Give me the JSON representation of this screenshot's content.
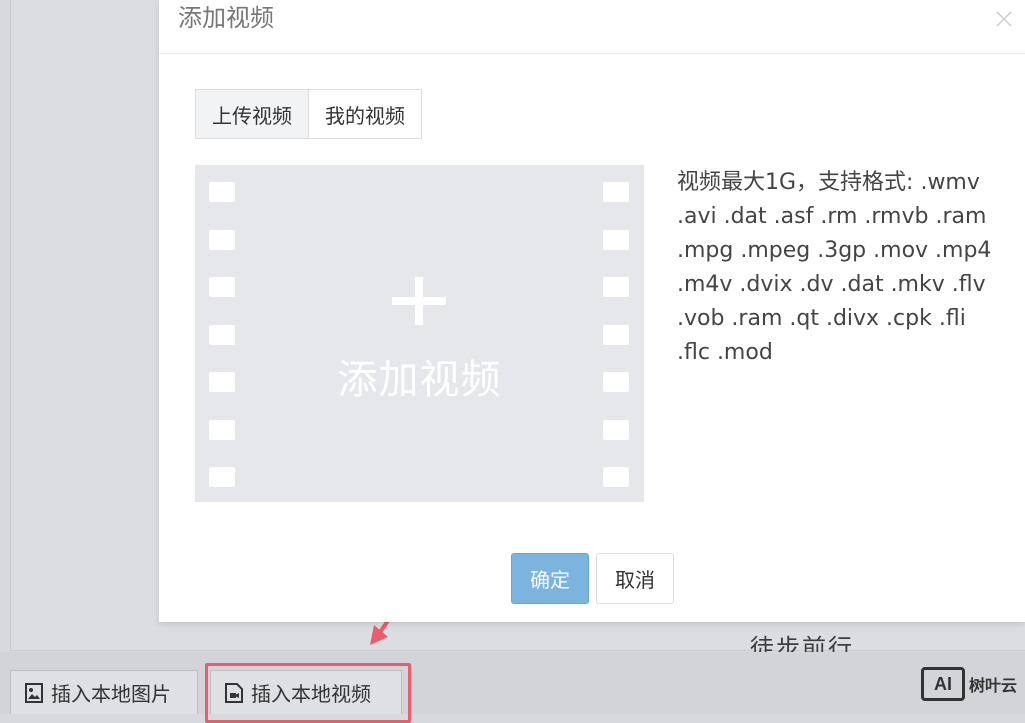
{
  "background": {
    "editor_text": "徒步前行"
  },
  "toolbar": {
    "insert_image_label": "插入本地图片",
    "insert_video_label": "插入本地视频"
  },
  "watermark": {
    "logo": "AI",
    "text": "树叶云"
  },
  "modal": {
    "title": "添加视频",
    "tabs": [
      {
        "label": "上传视频",
        "active": true
      },
      {
        "label": "我的视频",
        "active": false
      }
    ],
    "upload": {
      "label": "添加视频"
    },
    "format_info": [
      "视频最大1G，支持格式: .wmv",
      ".avi .dat .asf .rm .rmvb .ram",
      ".mpg .mpeg .3gp .mov .mp4",
      ".m4v .dvix .dv .dat .mkv .flv",
      ".vob .ram .qt .divx .cpk .fli",
      ".flc .mod"
    ],
    "buttons": {
      "ok_label": "确定",
      "cancel_label": "取消"
    }
  },
  "colors": {
    "primary_button": "#7ab4df",
    "highlight": "#ea5c6e",
    "upload_bg": "#e6e7ea"
  },
  "icons": {
    "close": "close-icon",
    "plus": "plus-icon",
    "image": "image-icon",
    "video": "video-file-icon",
    "arrow": "arrow-icon"
  }
}
